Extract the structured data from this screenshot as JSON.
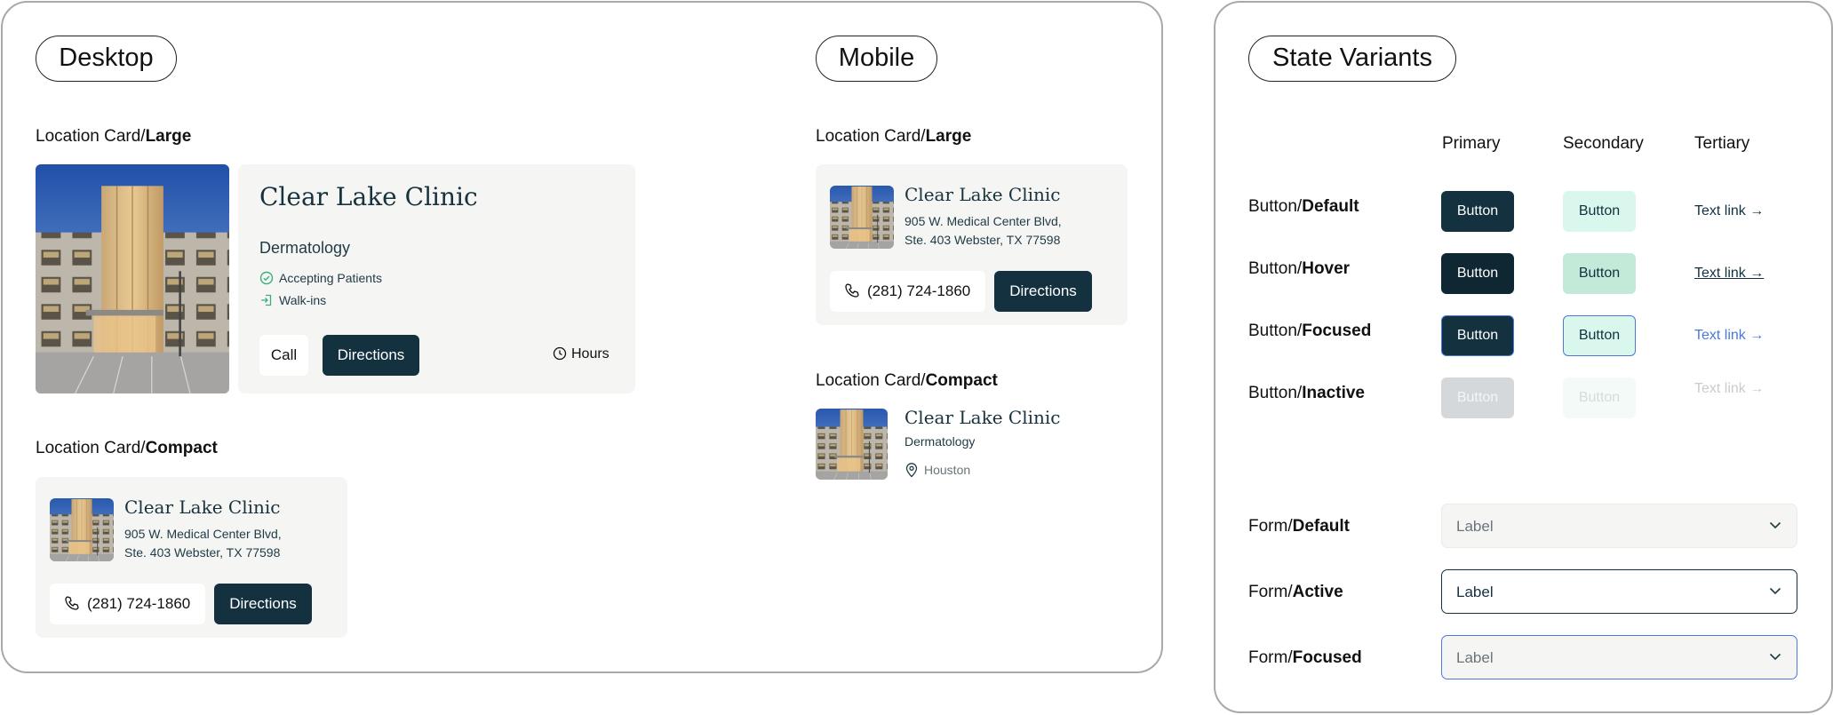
{
  "desktop": {
    "title": "Desktop",
    "large_label": {
      "prefix": "Location Card/",
      "bold": "Large"
    },
    "large_card": {
      "name": "Clear Lake Clinic",
      "specialty": "Dermatology",
      "features": [
        "Accepting Patients",
        "Walk-ins"
      ],
      "call_label": "Call",
      "directions_label": "Directions",
      "hours_label": "Hours"
    },
    "compact_label": {
      "prefix": "Location Card/",
      "bold": "Compact"
    },
    "compact_card": {
      "name": "Clear Lake Clinic",
      "address_line1": "905 W. Medical Center Blvd,",
      "address_line2": "Ste. 403 Webster, TX 77598",
      "phone": "(281) 724-1860",
      "directions_label": "Directions"
    }
  },
  "mobile": {
    "title": "Mobile",
    "large_label": {
      "prefix": "Location Card/",
      "bold": "Large"
    },
    "large_card": {
      "name": "Clear Lake Clinic",
      "address_line1": "905 W. Medical Center Blvd,",
      "address_line2": "Ste. 403 Webster, TX 77598",
      "phone": "(281) 724-1860",
      "directions_label": "Directions"
    },
    "compact_label": {
      "prefix": "Location Card/",
      "bold": "Compact"
    },
    "compact_card": {
      "name": "Clear Lake Clinic",
      "specialty": "Dermatology",
      "city": "Houston"
    }
  },
  "states": {
    "title": "State Variants",
    "columns": [
      "Primary",
      "Secondary",
      "Tertiary"
    ],
    "button_rows": [
      {
        "prefix": "Button/",
        "bold": "Default",
        "button_label": "Button",
        "link_label": "Text link →"
      },
      {
        "prefix": "Button/",
        "bold": "Hover",
        "button_label": "Button",
        "link_label": "Text link →"
      },
      {
        "prefix": "Button/",
        "bold": "Focused",
        "button_label": "Button",
        "link_label": "Text link →"
      },
      {
        "prefix": "Button/",
        "bold": "Inactive",
        "button_label": "Button",
        "link_label": "Text link →"
      }
    ],
    "form_rows": [
      {
        "prefix": "Form/",
        "bold": "Default",
        "value": "Label"
      },
      {
        "prefix": "Form/",
        "bold": "Active",
        "value": "Label"
      },
      {
        "prefix": "Form/",
        "bold": "Focused",
        "value": "Label"
      }
    ]
  },
  "colors": {
    "brand_dark": "#143140",
    "secondary_mint": "#d9f7ec",
    "focus_blue": "#4a78e0",
    "card_bg": "#f5f5f4"
  },
  "icons": [
    "check-circle-icon",
    "walk-in-icon",
    "clock-icon",
    "phone-icon",
    "map-pin-icon",
    "chevron-down-icon",
    "arrow-right-icon"
  ]
}
